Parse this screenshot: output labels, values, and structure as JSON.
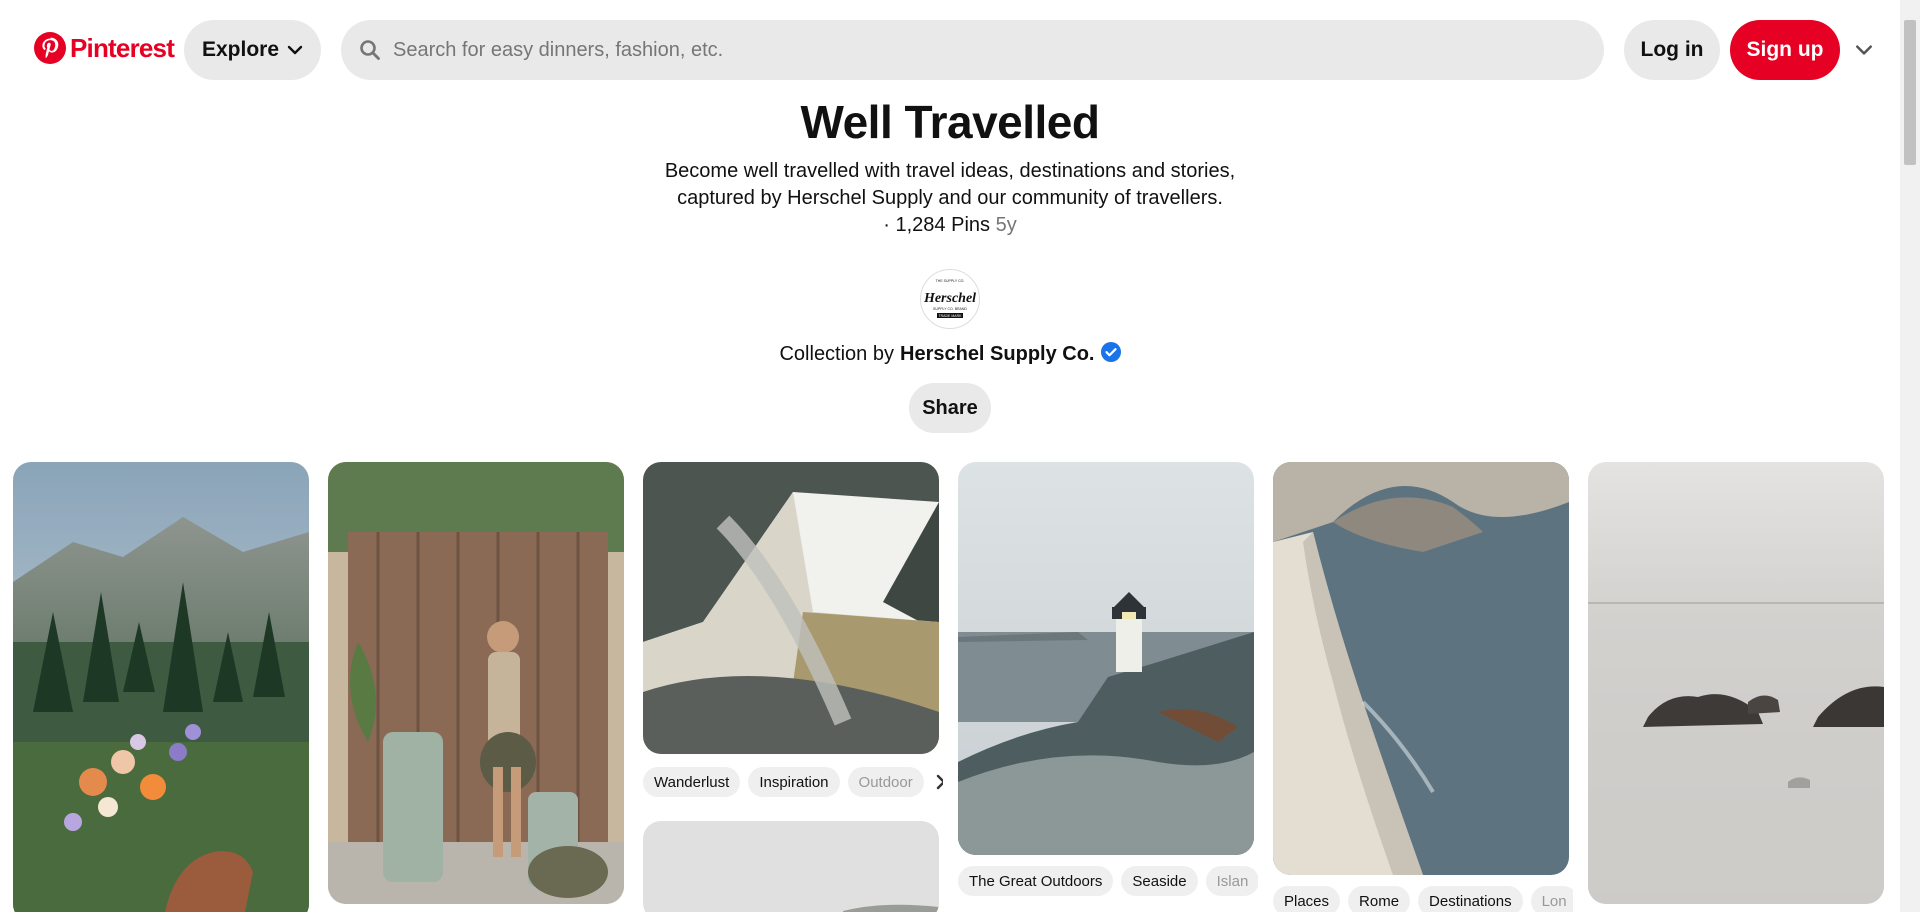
{
  "brand": {
    "name": "Pinterest",
    "color": "#e60023"
  },
  "header": {
    "explore_label": "Explore",
    "search_placeholder": "Search for easy dinners, fashion, etc.",
    "search_value": "",
    "login_label": "Log in",
    "signup_label": "Sign up"
  },
  "board": {
    "title": "Well Travelled",
    "description_line1": "Become well travelled with travel ideas, destinations and stories,",
    "description_line2": "captured by Herschel Supply and our community of travellers.",
    "pins_count": "· 1,284 Pins",
    "age": "5y",
    "collection_prefix": "Collection by",
    "owner": "Herschel Supply Co.",
    "verified_color": "#1a73e8",
    "share_label": "Share",
    "avatar_logo": "Herschel"
  },
  "pins": [
    {
      "id": "pin-1",
      "scene": "alpine-wildflowers",
      "tags": []
    },
    {
      "id": "pin-2",
      "scene": "traveller-with-luggage",
      "tags": []
    },
    {
      "id": "pin-3",
      "scene": "hammock-tent",
      "tags": [
        "Wanderlust",
        "Inspiration",
        "Outdoor"
      ]
    },
    {
      "id": "pin-4",
      "scene": "lighthouse-rocks",
      "tags": [
        "The Great Outdoors",
        "Seaside",
        "Islan"
      ]
    },
    {
      "id": "pin-5",
      "scene": "cliff-cove",
      "tags": [
        "Places",
        "Rome",
        "Destinations",
        "Lon"
      ]
    },
    {
      "id": "pin-6",
      "scene": "misty-sea-rocks",
      "tags": []
    },
    {
      "id": "pin-7",
      "scene": "overcast-landscape",
      "tags": []
    }
  ]
}
